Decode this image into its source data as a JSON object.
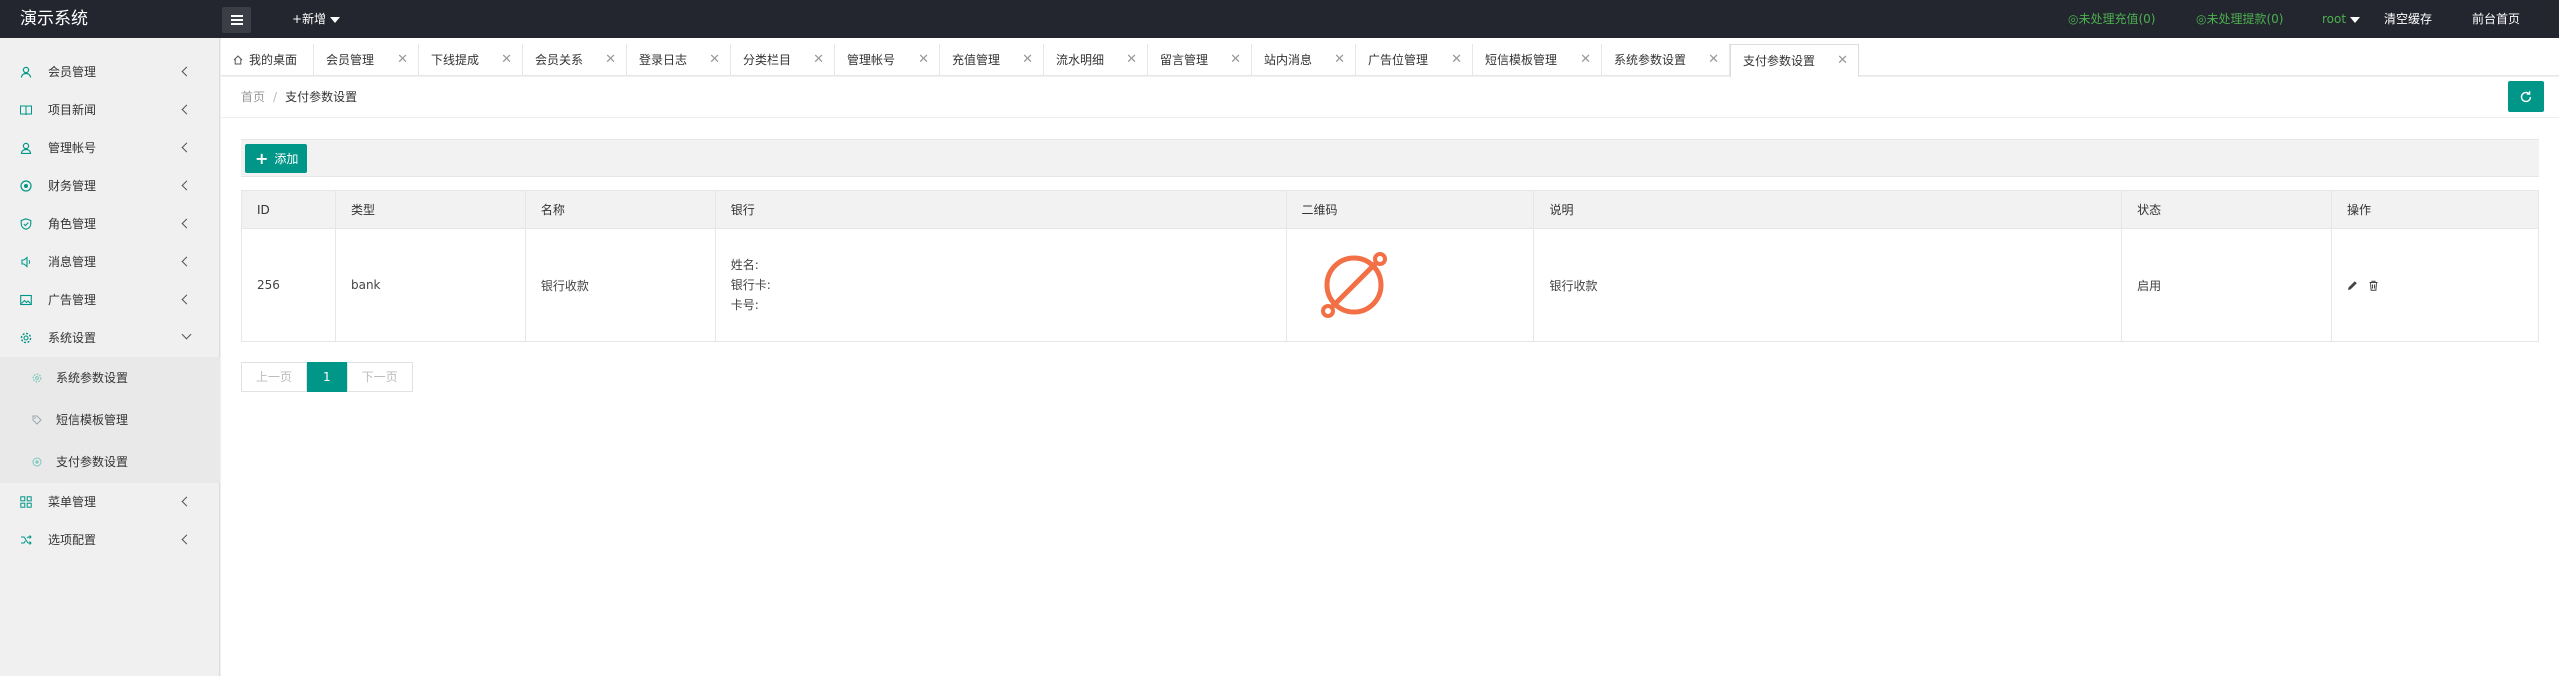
{
  "header": {
    "logo": "演示系统",
    "add_new": "+新增",
    "unprocessed_recharge": "◎未处理充值(0)",
    "unprocessed_withdraw": "◎未处理提款(0)",
    "user": "root",
    "clear_cache": "清空缓存",
    "frontend_home": "前台首页"
  },
  "sidebar": {
    "items": [
      {
        "label": "会员管理",
        "icon": "user-icon"
      },
      {
        "label": "项目新闻",
        "icon": "book-icon"
      },
      {
        "label": "管理帐号",
        "icon": "admin-user-icon"
      },
      {
        "label": "财务管理",
        "icon": "finance-icon"
      },
      {
        "label": "角色管理",
        "icon": "shield-check-icon"
      },
      {
        "label": "消息管理",
        "icon": "speaker-icon"
      },
      {
        "label": "广告管理",
        "icon": "image-icon"
      },
      {
        "label": "系统设置",
        "icon": "gear-icon"
      }
    ],
    "sub_items": [
      {
        "label": "系统参数设置",
        "icon": "gear-small-icon"
      },
      {
        "label": "短信模板管理",
        "icon": "tag-icon"
      },
      {
        "label": "支付参数设置",
        "icon": "target-icon"
      }
    ],
    "bottom_items": [
      {
        "label": "菜单管理",
        "icon": "grid-icon"
      },
      {
        "label": "选项配置",
        "icon": "shuffle-icon"
      }
    ]
  },
  "tabs": [
    {
      "label": "我的桌面"
    },
    {
      "label": "会员管理"
    },
    {
      "label": "下线提成"
    },
    {
      "label": "会员关系"
    },
    {
      "label": "登录日志"
    },
    {
      "label": "分类栏目"
    },
    {
      "label": "管理帐号"
    },
    {
      "label": "充值管理"
    },
    {
      "label": "流水明细"
    },
    {
      "label": "留言管理"
    },
    {
      "label": "站内消息"
    },
    {
      "label": "广告位管理"
    },
    {
      "label": "短信模板管理"
    },
    {
      "label": "系统参数设置"
    },
    {
      "label": "支付参数设置"
    }
  ],
  "breadcrumb": {
    "home": "首页",
    "separator": "/",
    "current": "支付参数设置"
  },
  "toolbar": {
    "add_label": "添加"
  },
  "table": {
    "headers": [
      "ID",
      "类型",
      "名称",
      "银行",
      "二维码",
      "说明",
      "状态",
      "操作"
    ],
    "rows": [
      {
        "id": "256",
        "type": "bank",
        "name": "银行收款",
        "bank_name": "姓名:",
        "bank_card": "银行卡:",
        "card_no": "卡号:",
        "description": "银行收款",
        "status": "启用"
      }
    ]
  },
  "pager": {
    "prev": "上一页",
    "current": "1",
    "next": "下一页"
  },
  "colors": {
    "accent": "#009688",
    "header_bg": "#23262e",
    "green_text": "#4caf50",
    "qr_orange": "#f36f45"
  }
}
